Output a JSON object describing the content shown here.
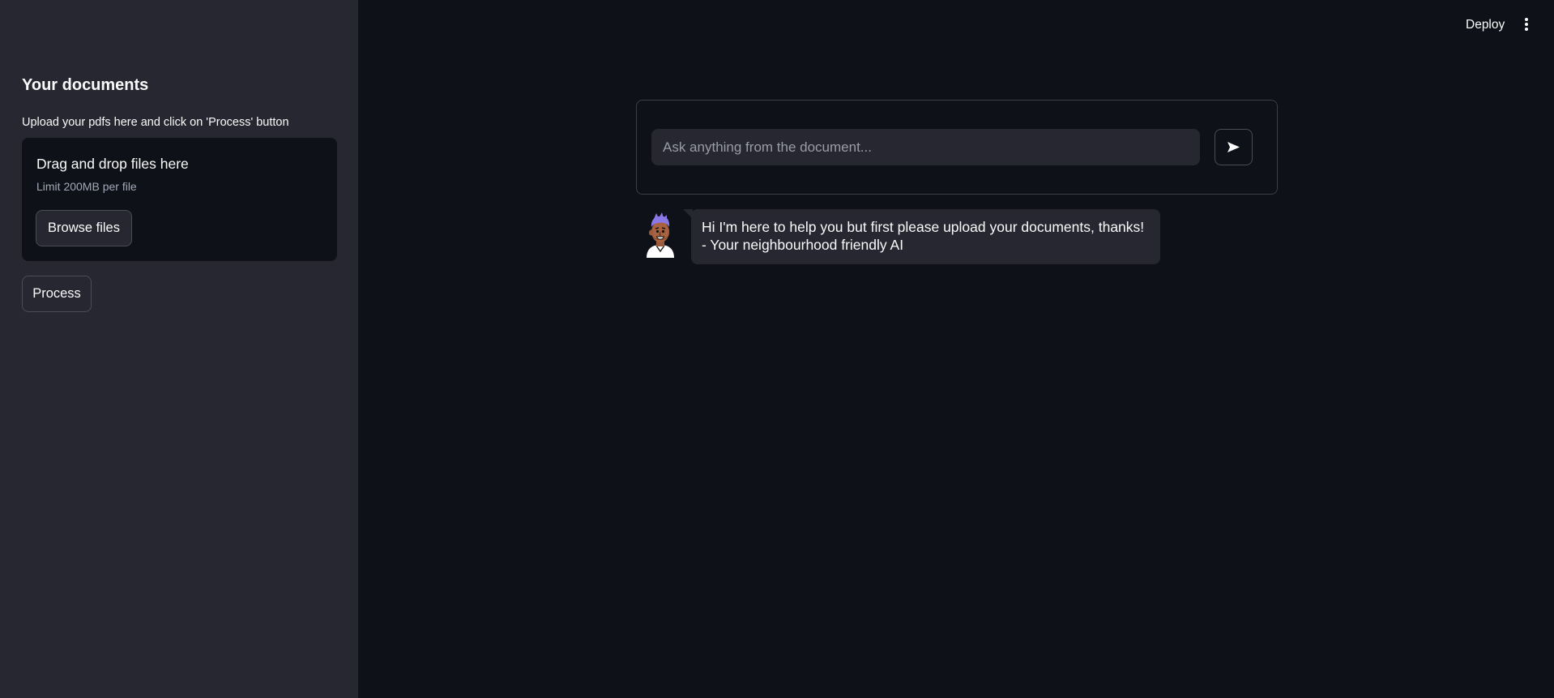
{
  "sidebar": {
    "title": "Your documents",
    "instructions": "Upload your pdfs here and click on 'Process' button",
    "uploader": {
      "title": "Drag and drop files here",
      "limit": "Limit 200MB per file",
      "browse_label": "Browse files"
    },
    "process_label": "Process"
  },
  "header": {
    "deploy_label": "Deploy",
    "menu_icon": "kebab-menu-icon"
  },
  "chat": {
    "input_placeholder": "Ask anything from the document...",
    "input_value": "",
    "send_icon": "send-icon",
    "messages": [
      {
        "role": "bot",
        "avatar_icon": "bot-avatar-icon",
        "text": "Hi I'm here to help you but first please upload your documents, thanks! - Your neighbourhood friendly AI"
      }
    ]
  },
  "colors": {
    "main_bg": "#0e1117",
    "sidebar_bg": "#262730",
    "text": "#fafafa",
    "muted_text": "#a3a8b8",
    "border": "#4a4c57"
  }
}
